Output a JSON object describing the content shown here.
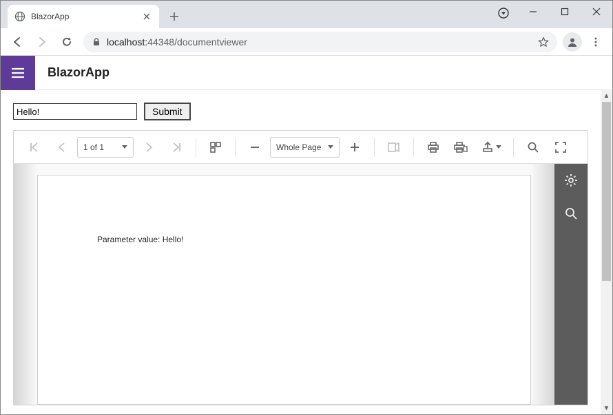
{
  "browser": {
    "tab_title": "BlazorApp",
    "url_host": "localhost:",
    "url_port_path": "44348/documentviewer"
  },
  "app": {
    "title": "BlazorApp"
  },
  "form": {
    "input_value": "Hello!",
    "submit_label": "Submit"
  },
  "viewer": {
    "page_selector": "1 of 1",
    "zoom_selector": "Whole Page",
    "document_text": "Parameter value: Hello!"
  }
}
